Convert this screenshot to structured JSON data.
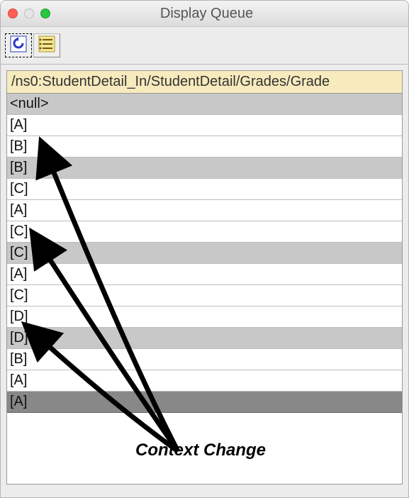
{
  "window": {
    "title": "Display Queue"
  },
  "toolbar": {
    "refresh_icon": "refresh",
    "list_icon": "list"
  },
  "header": {
    "path": "/ns0:StudentDetail_In/StudentDetail/Grades/Grade"
  },
  "rows": [
    {
      "text": "<null>",
      "kind": "null"
    },
    {
      "text": "[A]",
      "kind": "normal"
    },
    {
      "text": "[B]",
      "kind": "normal"
    },
    {
      "text": "[B]",
      "kind": "ctx"
    },
    {
      "text": "[C]",
      "kind": "normal"
    },
    {
      "text": "[A]",
      "kind": "normal"
    },
    {
      "text": "[C]",
      "kind": "normal"
    },
    {
      "text": "[C]",
      "kind": "ctx"
    },
    {
      "text": "[A]",
      "kind": "normal"
    },
    {
      "text": "[C]",
      "kind": "normal"
    },
    {
      "text": "[D]",
      "kind": "normal"
    },
    {
      "text": "[D]",
      "kind": "ctx"
    },
    {
      "text": "[B]",
      "kind": "normal"
    },
    {
      "text": "[A]",
      "kind": "normal"
    },
    {
      "text": "[A]",
      "kind": "last"
    }
  ],
  "annotation": {
    "label": "Context Change"
  }
}
